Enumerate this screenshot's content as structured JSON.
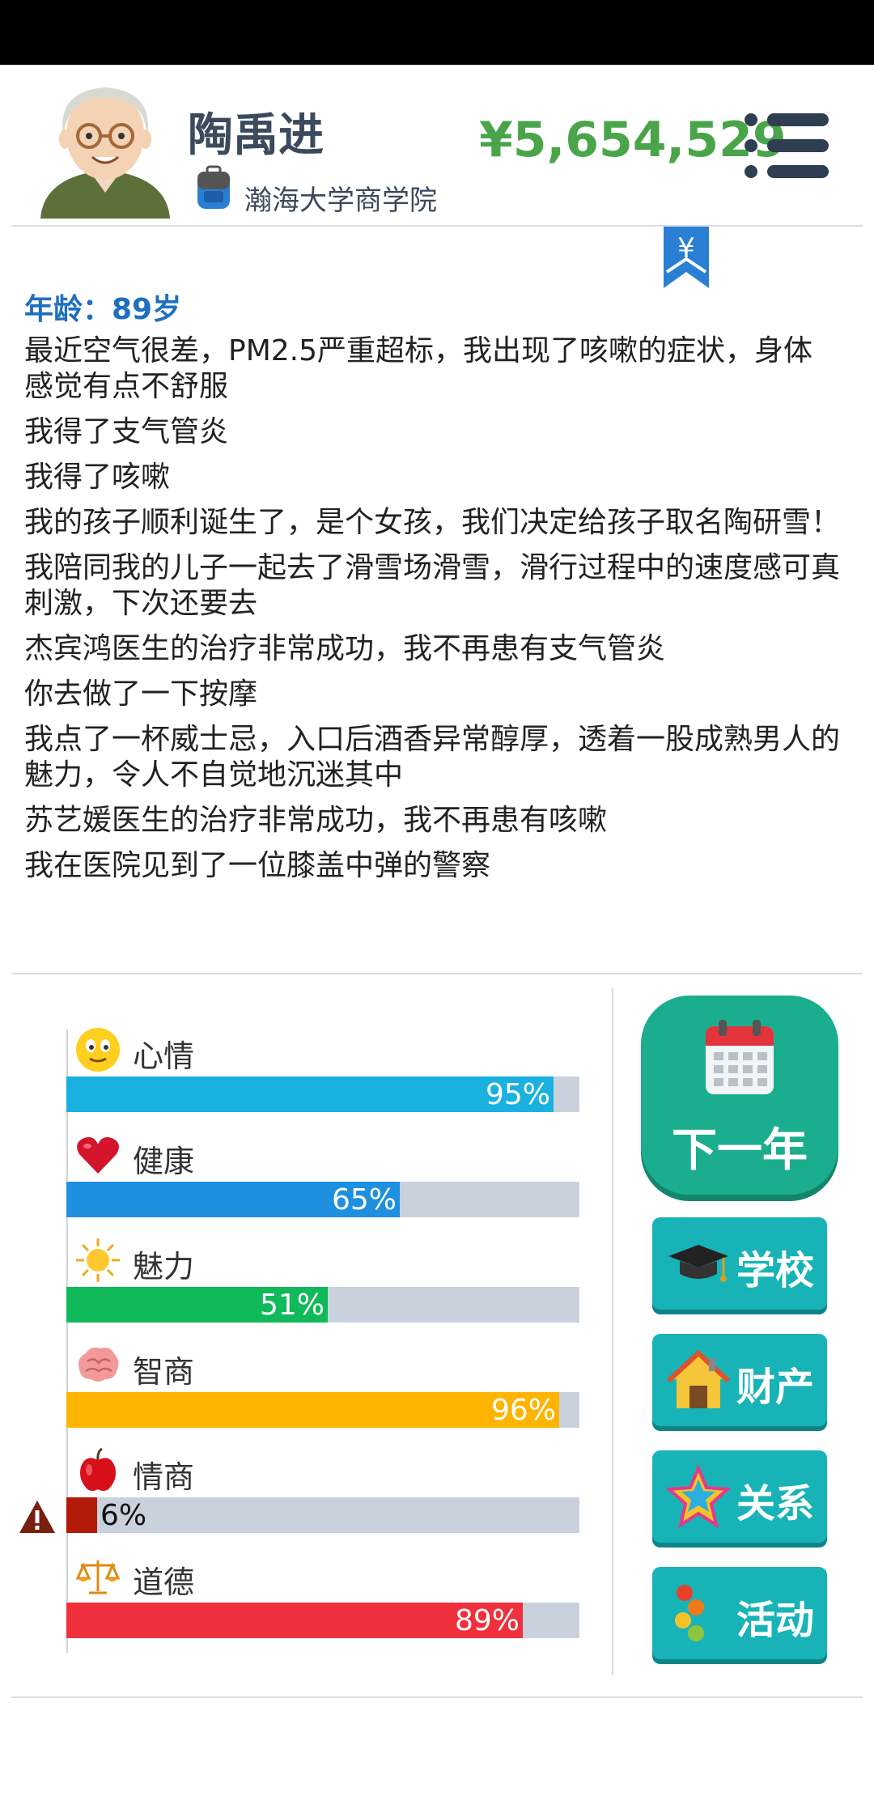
{
  "header": {
    "name": "陶禹进",
    "school": "瀚海大学商学院",
    "money": "¥5,654,529"
  },
  "log": {
    "age": "年龄：89岁",
    "entries": [
      "最近空气很差，PM2.5严重超标，我出现了咳嗽的症状，身体感觉有点不舒服",
      "我得了支气管炎",
      "我得了咳嗽",
      "我的孩子顺利诞生了，是个女孩，我们决定给孩子取名陶研雪！",
      "我陪同我的儿子一起去了滑雪场滑雪，滑行过程中的速度感可真刺激，下次还要去",
      "杰宾鸿医生的治疗非常成功，我不再患有支气管炎",
      "你去做了一下按摩",
      "我点了一杯威士忌，入口后酒香异常醇厚，透着一股成熟男人的魅力，令人不自觉地沉迷其中",
      "苏艺媛医生的治疗非常成功，我不再患有咳嗽",
      "我在医院见到了一位膝盖中弹的警察"
    ]
  },
  "stats": [
    {
      "label": "心情",
      "value": 95,
      "display": "95%",
      "color": "#1ab1e0",
      "icon": "smiley-icon"
    },
    {
      "label": "健康",
      "value": 65,
      "display": "65%",
      "color": "#1f8fe0",
      "icon": "heart-icon"
    },
    {
      "label": "魅力",
      "value": 51,
      "display": "51%",
      "color": "#10b95a",
      "icon": "sun-icon"
    },
    {
      "label": "智商",
      "value": 96,
      "display": "96%",
      "color": "#ffb400",
      "icon": "brain-icon"
    },
    {
      "label": "情商",
      "value": 6,
      "display": "6%",
      "color": "#b21a0a",
      "icon": "apple-icon"
    },
    {
      "label": "道德",
      "value": 89,
      "display": "89%",
      "color": "#f0303c",
      "icon": "scale-icon"
    }
  ],
  "actions": {
    "next_year": "下一年",
    "school": "学校",
    "property": "财产",
    "relations": "关系",
    "activities": "活动"
  }
}
